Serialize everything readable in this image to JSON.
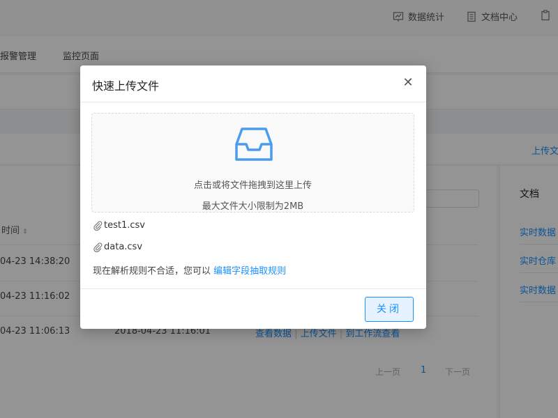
{
  "topnav": [
    {
      "icon": "chart-icon",
      "label": "数据统计"
    },
    {
      "icon": "document-icon",
      "label": "文档中心"
    }
  ],
  "tabs": [
    "报警管理",
    "监控页面"
  ],
  "upload_link": "上传文",
  "table": {
    "sort_header": "时间",
    "rows": [
      {
        "time": "04-23 14:38:20"
      },
      {
        "time": "04-23 11:16:02"
      },
      {
        "time": "04-23 11:06:13",
        "time2": "2018-04-23 11:16:01",
        "actions": [
          "查看数据",
          "上传文件",
          "到工作流查看"
        ]
      }
    ]
  },
  "pagination": {
    "prev": "上一页",
    "current": "1",
    "next": "下一页"
  },
  "side": {
    "title": "文档",
    "items": [
      "实时数据",
      "实时仓库",
      "实时数据"
    ]
  },
  "modal": {
    "title": "快速上传文件",
    "close_icon": "close-icon",
    "dropzone": {
      "icon": "inbox-icon",
      "primary_text": "点击或将文件拖拽到这里上传",
      "secondary_text": "最大文件大小限制为2MB"
    },
    "files": [
      {
        "icon": "paperclip-icon",
        "name": "test1.csv"
      },
      {
        "icon": "paperclip-icon",
        "name": "data.csv"
      }
    ],
    "hint_text": "现在解析规则不合适，您可以",
    "hint_link": "编辑字段抽取规则",
    "close_button": "关闭"
  },
  "colors": {
    "accent": "#1890ff",
    "overlay": "rgba(0,0,0,0.42)"
  }
}
